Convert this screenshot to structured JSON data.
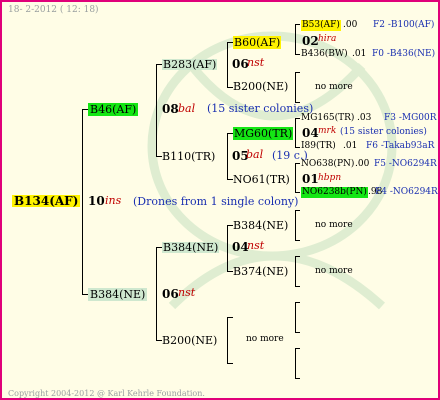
{
  "header": {
    "date": "18-  2-2012 ( 12: 18)"
  },
  "footer": {
    "copyright": "Copyright 2004-2012 @ Karl Kehrle Foundation."
  },
  "colors": {
    "border": "#e0007a",
    "background": "#fffde6",
    "highlight_yellow": "#fff300",
    "highlight_green": "#14e614",
    "red_text": "#c00000",
    "blue_text": "#1a2fb0"
  },
  "root": {
    "id": "B134(AF)",
    "gen": "10",
    "name": "ins",
    "note": "(Drones from 1 single colony)"
  },
  "g1": [
    {
      "id": "B46(AF)",
      "gen": "08",
      "name": "bal",
      "note": "(15 sister colonies)"
    },
    {
      "id": "B384(NE)",
      "gen": "06",
      "name": "nst"
    }
  ],
  "g2": [
    {
      "id": "B283(AF)",
      "gen": "06",
      "name": "nst"
    },
    {
      "id": "B110(TR)",
      "gen": "05",
      "name": "bal",
      "note": "(19 c.)"
    },
    {
      "id": "B384(NE)",
      "gen": "04",
      "name": "nst"
    },
    {
      "id": "B200(NE)",
      "nomore": "no more"
    }
  ],
  "g3": [
    {
      "id": "B60(AF)",
      "gen": "02",
      "name": "hira"
    },
    {
      "id": "B200(NE)",
      "nomore": "no more"
    },
    {
      "id": "MG60(TR)",
      "gen": "04",
      "name": "mrk",
      "note": "(15 sister colonies)"
    },
    {
      "id": "NO61(TR)",
      "gen": "01",
      "name": "hbpn"
    },
    {
      "id": "B384(NE)",
      "nomore": "no more"
    },
    {
      "id": "B374(NE)",
      "nomore": "no more"
    }
  ],
  "g4": [
    {
      "id": "B53(AF)",
      "val": ".00",
      "ref": "F2 -B100(AF)"
    },
    {
      "id": "B436(BW)",
      "val": ".01",
      "ref": "F0 -B436(NE)"
    },
    {
      "id": "MG165(TR)",
      "val": ".03",
      "ref": "F3 -MG00R"
    },
    {
      "id": "I89(TR)",
      "val": ".01",
      "ref": "F6 -Takab93aR"
    },
    {
      "id": "NO638(PN)",
      "val": ".00",
      "ref": "F5 -NO6294R"
    },
    {
      "id": "NO6238b(PN)",
      "val": ".98",
      "ref": "F4 -NO6294R"
    }
  ]
}
